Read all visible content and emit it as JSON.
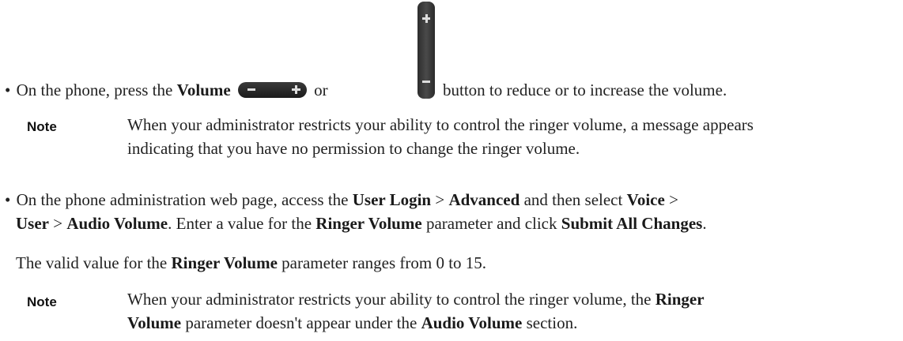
{
  "bullet1": {
    "bullet": "•",
    "prefix": "On the phone, press the",
    "volume": "Volume",
    "or": "or",
    "suffix": "button to reduce or to increase the volume.",
    "icons": [
      "volume-rocker-horizontal-icon",
      "volume-rocker-vertical-icon"
    ]
  },
  "note1": {
    "label": "Note",
    "line1": "When your administrator restricts your ability to control the ringer volume, a message appears",
    "line2": "indicating that you have no permission to change the ringer volume."
  },
  "bullet2": {
    "bullet": "•",
    "l1_a": "On the phone administration web page, access the",
    "l1_userlogin": "User Login",
    "l1_gt1": ">",
    "l1_advanced": "Advanced",
    "l1_b": "and then select",
    "l1_voice": "Voice",
    "l1_gt2": ">",
    "l2_user": "User",
    "l2_gt": ">",
    "l2_audio": "Audio Volume",
    "l2_a": ". Enter a value for the",
    "l2_ringer": "Ringer Volume",
    "l2_b": "parameter and click",
    "l2_submit": "Submit All Changes",
    "l2_end": "."
  },
  "valid": {
    "a": "The valid value for the",
    "ringer": "Ringer Volume",
    "b": "parameter ranges from 0 to 15."
  },
  "note2": {
    "label": "Note",
    "l1_a": "When your administrator restricts your ability to control the ringer volume, the",
    "l1_ringer": "Ringer",
    "l2_volume": "Volume",
    "l2_a": "parameter doesn't appear under the",
    "l2_audio": "Audio Volume",
    "l2_b": "section."
  }
}
